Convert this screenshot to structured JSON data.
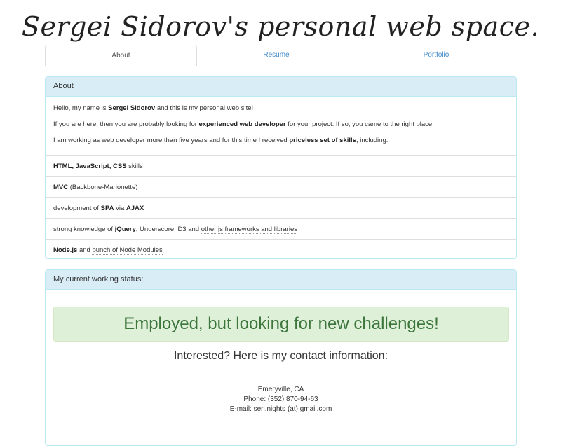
{
  "site": {
    "title": "Sergei Sidorov's personal web space."
  },
  "tabs": [
    {
      "label": "About"
    },
    {
      "label": "Resume"
    },
    {
      "label": "Portfolio"
    }
  ],
  "about": {
    "heading": "About",
    "intro": {
      "p1_before": "Hello, my name is ",
      "p1_bold": "Sergei Sidorov",
      "p1_after": " and this is my personal web site!",
      "p2_before": "If you are here, then you are probably looking for ",
      "p2_bold": "experienced web developer",
      "p2_after": " for your project. If so, you came to the right place.",
      "p3_before": "I am working as web developer more than five years and for this time I received ",
      "p3_bold": "priceless set of skills",
      "p3_after": ", including:"
    },
    "skills": [
      {
        "bold": "HTML, JavaScript, CSS",
        "text": " skills"
      },
      {
        "bold": "MVC",
        "text": " (Backbone-Marionette)"
      },
      {
        "pre": "development of ",
        "bold": "SPA",
        "mid": " via ",
        "bold2": "AJAX"
      },
      {
        "pre": "strong knowledge of ",
        "bold": "jQuery",
        "mid": ", Underscore, D3 and ",
        "dotted": "other js frameworks and libraries"
      },
      {
        "bold": "Node.js",
        "mid": " and ",
        "dotted": "bunch of Node Modules"
      }
    ]
  },
  "status": {
    "heading": "My current working status:",
    "alert": "Employed, but looking for new challenges!",
    "contact_title": "Interested? Here is my contact information:",
    "location": "Emeryville, CA",
    "phone": "Phone: (352) 870-94-63",
    "email": "E-mail: serj.nights (at) gmail.com"
  }
}
